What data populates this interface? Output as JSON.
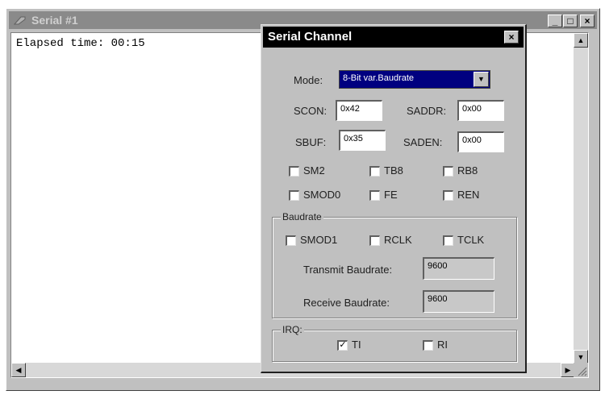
{
  "serial_window": {
    "title": "Serial #1",
    "output_text": "Elapsed time: 00:15",
    "minimize": "_",
    "maximize": "□",
    "close": "×"
  },
  "dialog": {
    "title": "Serial Channel",
    "close": "×",
    "mode_label": "Mode:",
    "mode_value": "8-Bit var.Baudrate",
    "scon_label": "SCON:",
    "scon_value": "0x42",
    "saddr_label": "SADDR:",
    "saddr_value": "0x00",
    "sbuf_label": "SBUF:",
    "sbuf_value": "0x35",
    "saden_label": "SADEN:",
    "saden_value": "0x00",
    "checkboxes": {
      "sm2": {
        "label": "SM2",
        "mark": ""
      },
      "tb8": {
        "label": "TB8",
        "mark": ""
      },
      "rb8": {
        "label": "RB8",
        "mark": ""
      },
      "smod0": {
        "label": "SMOD0",
        "mark": ""
      },
      "fe": {
        "label": "FE",
        "mark": ""
      },
      "ren": {
        "label": "REN",
        "mark": ""
      }
    },
    "baudrate_group": {
      "title": "Baudrate",
      "smod1": {
        "label": "SMOD1",
        "mark": ""
      },
      "rclk": {
        "label": "RCLK",
        "mark": ""
      },
      "tclk": {
        "label": "TCLK",
        "mark": ""
      },
      "transmit_label": "Transmit Baudrate:",
      "transmit_value": "9600",
      "receive_label": "Receive Baudrate:",
      "receive_value": "9600"
    },
    "irq_group": {
      "title": "IRQ:",
      "ti": {
        "label": "TI",
        "mark": "✓",
        "checked": true
      },
      "ri": {
        "label": "RI",
        "mark": "",
        "checked": false
      }
    }
  }
}
